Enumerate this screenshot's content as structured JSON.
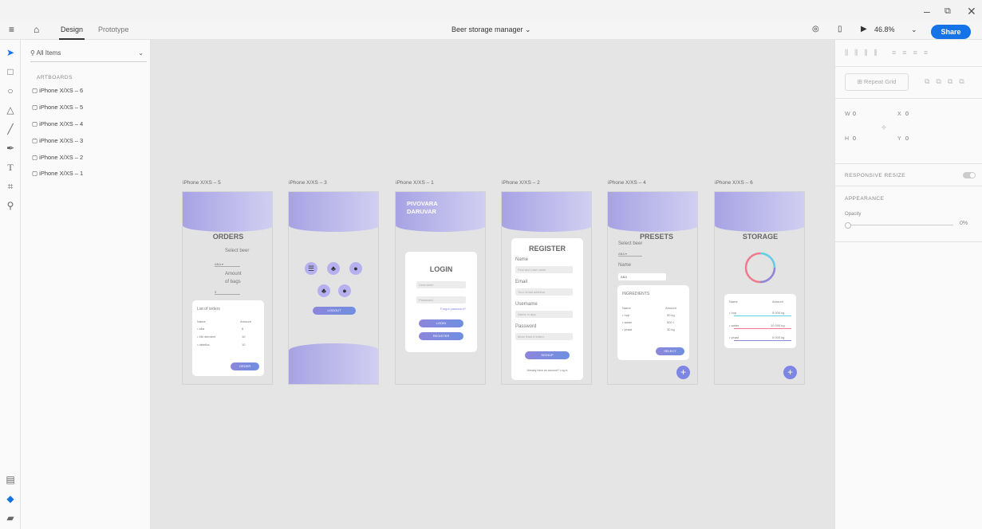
{
  "window": {
    "minimize": "–",
    "restore": "⧉",
    "close": "✕"
  },
  "toolbar": {
    "menu_icon": "≡",
    "home_icon": "⌂",
    "design_tab": "Design",
    "prototype_tab": "Prototype",
    "doc_title": "Beer storage manager ⌄",
    "zoom": "46.8%",
    "share_label": "Share"
  },
  "layers": {
    "search_placeholder": "All Items",
    "section": "ARTBOARDS",
    "items": [
      "iPhone X/XS – 6",
      "iPhone X/XS – 5",
      "iPhone X/XS – 4",
      "iPhone X/XS – 3",
      "iPhone X/XS – 2",
      "iPhone X/XS – 1"
    ]
  },
  "artboards": {
    "labels": [
      "iPhone X/XS – 5",
      "iPhone X/XS – 3",
      "iPhone X/XS – 1",
      "iPhone X/XS – 2",
      "iPhone X/XS – 4",
      "iPhone X/XS – 6"
    ]
  },
  "orders": {
    "title": "ORDERS",
    "select_beer": "Select beer",
    "beer_value": "ABA",
    "amount": "Amount",
    "of_bags": "of bags",
    "amount_value": "5",
    "list_title": "List of orders",
    "col_name": "Name",
    "col_amount": "Amount",
    "rows": [
      [
        "aba",
        "6"
      ],
      [
        "5th element",
        "10"
      ],
      [
        "detelka",
        "10"
      ]
    ],
    "order_btn": "ORDER"
  },
  "menu": {
    "logout": "LOGOUT"
  },
  "login": {
    "brand1": "PIVOVARA",
    "brand2": "DARUVAR",
    "title": "LOGIN",
    "user_ph": "Username",
    "pass_ph": "Password",
    "forgot": "Forgot password?",
    "login_btn": "LOGIN",
    "register_btn": "REGISTER"
  },
  "register": {
    "title": "REGISTER",
    "name": "Name",
    "name_ph": "First and Last name",
    "email": "Email",
    "email_ph": "Your email address",
    "username": "Username",
    "username_ph": "Name in app",
    "password": "Password",
    "password_ph": "More than 6 letters",
    "signup": "SIGNUP",
    "already": "Already have an account? Log in"
  },
  "presets": {
    "title": "PRESETS",
    "select_beer": "Select beer",
    "beer_value": "ABA",
    "name": "Name",
    "name_value": "ABA",
    "ingredients": "INGREDIENTS",
    "col_name": "Name",
    "col_amount": "Amount",
    "rows": [
      [
        "hop",
        "50 kg"
      ],
      [
        "water",
        "500 l"
      ],
      [
        "yeast",
        "30 kg"
      ]
    ],
    "select_btn": "SELECT",
    "fab": "+"
  },
  "storage": {
    "title": "STORAGE",
    "col_name": "Name",
    "col_amount": "Amount",
    "rows": [
      [
        "hop",
        "5 000 kg"
      ],
      [
        "water",
        "10 000 kg"
      ],
      [
        "yeast",
        "5 000 kg"
      ]
    ],
    "fab": "+"
  },
  "props": {
    "repeat_grid": "Repeat Grid",
    "w_label": "W",
    "w_val": "0",
    "x_label": "X",
    "x_val": "0",
    "h_label": "H",
    "h_val": "0",
    "y_label": "Y",
    "y_val": "0",
    "responsive": "RESPONSIVE RESIZE",
    "appearance": "APPEARANCE",
    "opacity_label": "Opacity",
    "opacity_val": "0%"
  }
}
